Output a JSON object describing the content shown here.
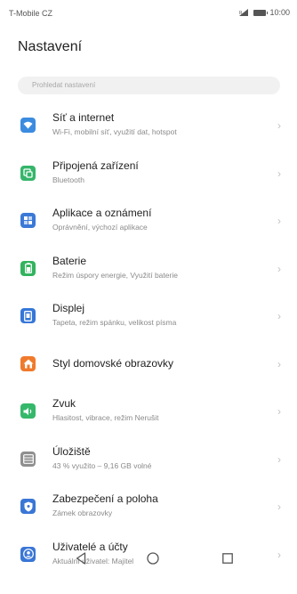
{
  "status": {
    "carrier": "T-Mobile CZ",
    "time": "10:00"
  },
  "header": {
    "title": "Nastavení"
  },
  "search": {
    "placeholder": "Prohledat nastavení"
  },
  "items": [
    {
      "name": "wifi",
      "label": "Síť a internet",
      "sub": "Wi-Fi, mobilní síť, využití dat, hotspot",
      "color": "#3b8be0",
      "icon": "wifi-icon"
    },
    {
      "name": "devices",
      "label": "Připojená zařízení",
      "sub": "Bluetooth",
      "color": "#35b56a",
      "icon": "connected-devices-icon"
    },
    {
      "name": "apps",
      "label": "Aplikace a oznámení",
      "sub": "Oprávnění, výchozí aplikace",
      "color": "#3b79d6",
      "icon": "apps-icon"
    },
    {
      "name": "battery",
      "label": "Baterie",
      "sub": "Režim úspory energie, Využití baterie",
      "color": "#33b35f",
      "icon": "battery-icon"
    },
    {
      "name": "display",
      "label": "Displej",
      "sub": "Tapeta, režim spánku, velikost písma",
      "color": "#3576d8",
      "icon": "display-icon"
    },
    {
      "name": "home-style",
      "label": "Styl domovské obrazovky",
      "sub": "",
      "color": "#f07a2b",
      "icon": "home-icon"
    },
    {
      "name": "sound",
      "label": "Zvuk",
      "sub": "Hlasitost, vibrace, režim Nerušit",
      "color": "#35b86a",
      "icon": "speaker-icon"
    },
    {
      "name": "storage",
      "label": "Úložiště",
      "sub": "43 % využito – 9,16 GB volné",
      "color": "#8f8f8f",
      "icon": "storage-icon"
    },
    {
      "name": "security",
      "label": "Zabezpečení a poloha",
      "sub": "Zámek obrazovky",
      "color": "#3a76d6",
      "icon": "shield-icon"
    },
    {
      "name": "accounts",
      "label": "Uživatelé a účty",
      "sub": "Aktuální uživatel: Majitel",
      "color": "#3a76d6",
      "icon": "user-icon"
    }
  ],
  "chevron": "›"
}
